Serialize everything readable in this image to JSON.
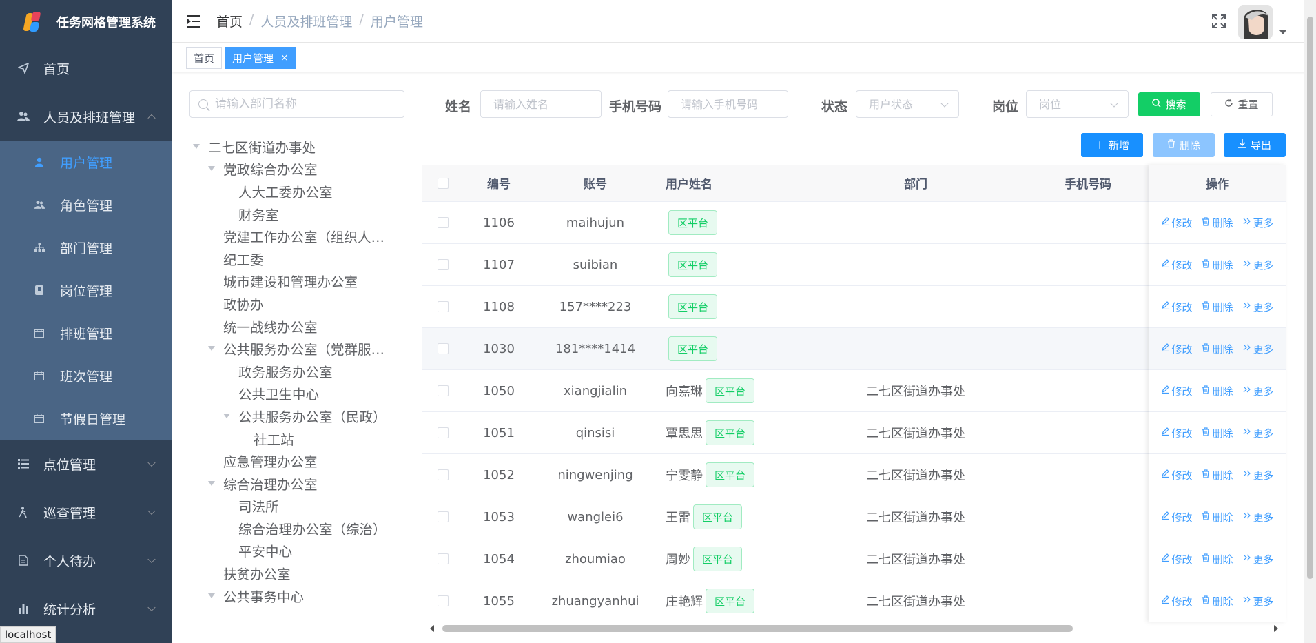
{
  "app": {
    "title": "任务网格管理系统"
  },
  "sidebar": {
    "home": "首页",
    "personnel": "人员及排班管理",
    "sub_items": [
      {
        "label": "用户管理",
        "icon": "user-icon"
      },
      {
        "label": "角色管理",
        "icon": "peoples-icon"
      },
      {
        "label": "部门管理",
        "icon": "tree-icon"
      },
      {
        "label": "岗位管理",
        "icon": "post-icon"
      },
      {
        "label": "排班管理",
        "icon": "calendar-icon"
      },
      {
        "label": "班次管理",
        "icon": "calendar-icon"
      },
      {
        "label": "节假日管理",
        "icon": "calendar-icon"
      }
    ],
    "groups": [
      {
        "label": "点位管理",
        "icon": "list-icon"
      },
      {
        "label": "巡查管理",
        "icon": "patrol-icon"
      },
      {
        "label": "个人待办",
        "icon": "todo-icon"
      },
      {
        "label": "统计分析",
        "icon": "chart-icon"
      }
    ]
  },
  "breadcrumb": [
    "首页",
    "人员及排班管理",
    "用户管理"
  ],
  "tags": {
    "home": "首页",
    "active": "用户管理",
    "close": "×"
  },
  "dept_search": {
    "placeholder": "请输入部门名称"
  },
  "tree": [
    {
      "label": "二七区街道办事处",
      "level": 0,
      "caret": true
    },
    {
      "label": "党政综合办公室",
      "level": 1,
      "caret": true
    },
    {
      "label": "人大工委办公室",
      "level": 2,
      "caret": false
    },
    {
      "label": "财务室",
      "level": 2,
      "caret": false
    },
    {
      "label": "党建工作办公室（组织人…",
      "level": 1,
      "caret": false
    },
    {
      "label": "纪工委",
      "level": 1,
      "caret": false
    },
    {
      "label": "城市建设和管理办公室",
      "level": 1,
      "caret": false
    },
    {
      "label": "政协办",
      "level": 1,
      "caret": false
    },
    {
      "label": "统一战线办公室",
      "level": 1,
      "caret": false
    },
    {
      "label": "公共服务办公室（党群服…",
      "level": 1,
      "caret": true
    },
    {
      "label": "政务服务办公室",
      "level": 2,
      "caret": false
    },
    {
      "label": "公共卫生中心",
      "level": 2,
      "caret": false
    },
    {
      "label": "公共服务办公室（民政）",
      "level": 2,
      "caret": true
    },
    {
      "label": "社工站",
      "level": 3,
      "caret": false
    },
    {
      "label": "应急管理办公室",
      "level": 1,
      "caret": false
    },
    {
      "label": "综合治理办公室",
      "level": 1,
      "caret": true
    },
    {
      "label": "司法所",
      "level": 2,
      "caret": false
    },
    {
      "label": "综合治理办公室（综治）",
      "level": 2,
      "caret": false
    },
    {
      "label": "平安中心",
      "level": 2,
      "caret": false
    },
    {
      "label": "扶贫办公室",
      "level": 1,
      "caret": false
    },
    {
      "label": "公共事务中心",
      "level": 1,
      "caret": true
    }
  ],
  "form": {
    "name_label": "姓名",
    "name_placeholder": "请输入姓名",
    "phone_label": "手机号码",
    "phone_placeholder": "请输入手机号码",
    "status_label": "状态",
    "status_placeholder": "用户状态",
    "post_label": "岗位",
    "post_placeholder": "岗位",
    "search_btn": "搜索",
    "reset_btn": "重置"
  },
  "toolbar": {
    "add": "新增",
    "delete": "删除",
    "export": "导出"
  },
  "table": {
    "headers": {
      "id": "编号",
      "account": "账号",
      "name": "用户姓名",
      "dept": "部门",
      "phone": "手机号码",
      "ops": "操作"
    },
    "ops": {
      "edit": "修改",
      "delete": "删除",
      "more": "更多"
    },
    "rows": [
      {
        "id": "1106",
        "account": "maihujun",
        "name": "",
        "badge": "区平台",
        "dept": "",
        "phone": ""
      },
      {
        "id": "1107",
        "account": "suibian",
        "name": "",
        "badge": "区平台",
        "dept": "",
        "phone": ""
      },
      {
        "id": "1108",
        "account": "157****223",
        "name": "",
        "badge": "区平台",
        "dept": "",
        "phone": ""
      },
      {
        "id": "1030",
        "account": "181****1414",
        "name": "",
        "badge": "区平台",
        "dept": "",
        "phone": ""
      },
      {
        "id": "1050",
        "account": "xiangjialin",
        "name": "向嘉琳",
        "badge": "区平台",
        "dept": "二七区街道办事处",
        "phone": ""
      },
      {
        "id": "1051",
        "account": "qinsisi",
        "name": "覃思思",
        "badge": "区平台",
        "dept": "二七区街道办事处",
        "phone": ""
      },
      {
        "id": "1052",
        "account": "ningwenjing",
        "name": "宁雯静",
        "badge": "区平台",
        "dept": "二七区街道办事处",
        "phone": ""
      },
      {
        "id": "1053",
        "account": "wanglei6",
        "name": "王雷",
        "badge": "区平台",
        "dept": "二七区街道办事处",
        "phone": ""
      },
      {
        "id": "1054",
        "account": "zhoumiao",
        "name": "周妙",
        "badge": "区平台",
        "dept": "二七区街道办事处",
        "phone": ""
      },
      {
        "id": "1055",
        "account": "zhuangyanhui",
        "name": "庄艳辉",
        "badge": "区平台",
        "dept": "二七区街道办事处",
        "phone": ""
      }
    ]
  },
  "status_bar": {
    "url": "localhost"
  },
  "colors": {
    "sidebar_bg": "#304156",
    "primary": "#1890ff",
    "success": "#13ce66"
  }
}
